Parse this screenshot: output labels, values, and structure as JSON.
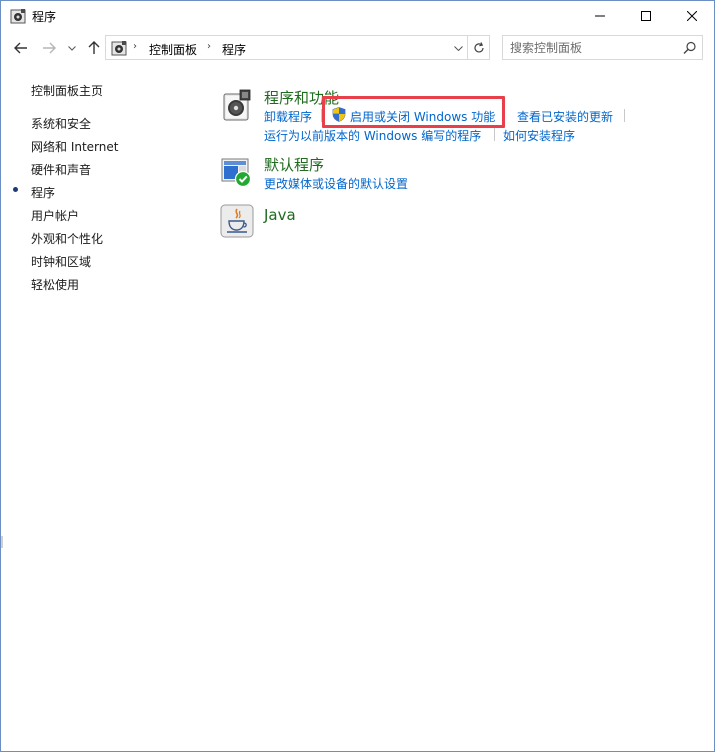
{
  "window": {
    "title": "程序",
    "icon": "control-panel-programs-icon"
  },
  "titlebar": {
    "minimize_icon": "minimize-icon",
    "maximize_icon": "maximize-icon",
    "close_icon": "close-icon"
  },
  "nav": {
    "back_icon": "arrow-left-icon",
    "forward_icon": "arrow-right-icon",
    "history_icon": "chevron-down-icon",
    "up_icon": "arrow-up-icon"
  },
  "address": {
    "crumbs": [
      "控制面板",
      "程序"
    ],
    "separator": "›",
    "refresh_icon": "refresh-icon"
  },
  "search": {
    "placeholder": "搜索控制面板",
    "icon": "search-icon"
  },
  "sidebar": {
    "home": "控制面板主页",
    "items": [
      {
        "label": "系统和安全",
        "current": false
      },
      {
        "label": "网络和 Internet",
        "current": false
      },
      {
        "label": "硬件和声音",
        "current": false
      },
      {
        "label": "程序",
        "current": true
      },
      {
        "label": "用户帐户",
        "current": false
      },
      {
        "label": "外观和个性化",
        "current": false
      },
      {
        "label": "时钟和区域",
        "current": false
      },
      {
        "label": "轻松使用",
        "current": false
      }
    ]
  },
  "main": {
    "categories": [
      {
        "title": "程序和功能",
        "icon": "programs-and-features-icon",
        "links": [
          "卸载程序",
          "启用或关闭 Windows 功能",
          "查看已安装的更新",
          "运行为以前版本的 Windows 编写的程序",
          "如何安装程序"
        ]
      },
      {
        "title": "默认程序",
        "icon": "default-programs-icon",
        "links": [
          "更改媒体或设备的默认设置"
        ]
      },
      {
        "title": "Java",
        "icon": "java-icon",
        "links": []
      }
    ]
  },
  "colors": {
    "category_title": "#1e6b1e",
    "link": "#0066cc",
    "highlight_box": "#e8404a"
  }
}
